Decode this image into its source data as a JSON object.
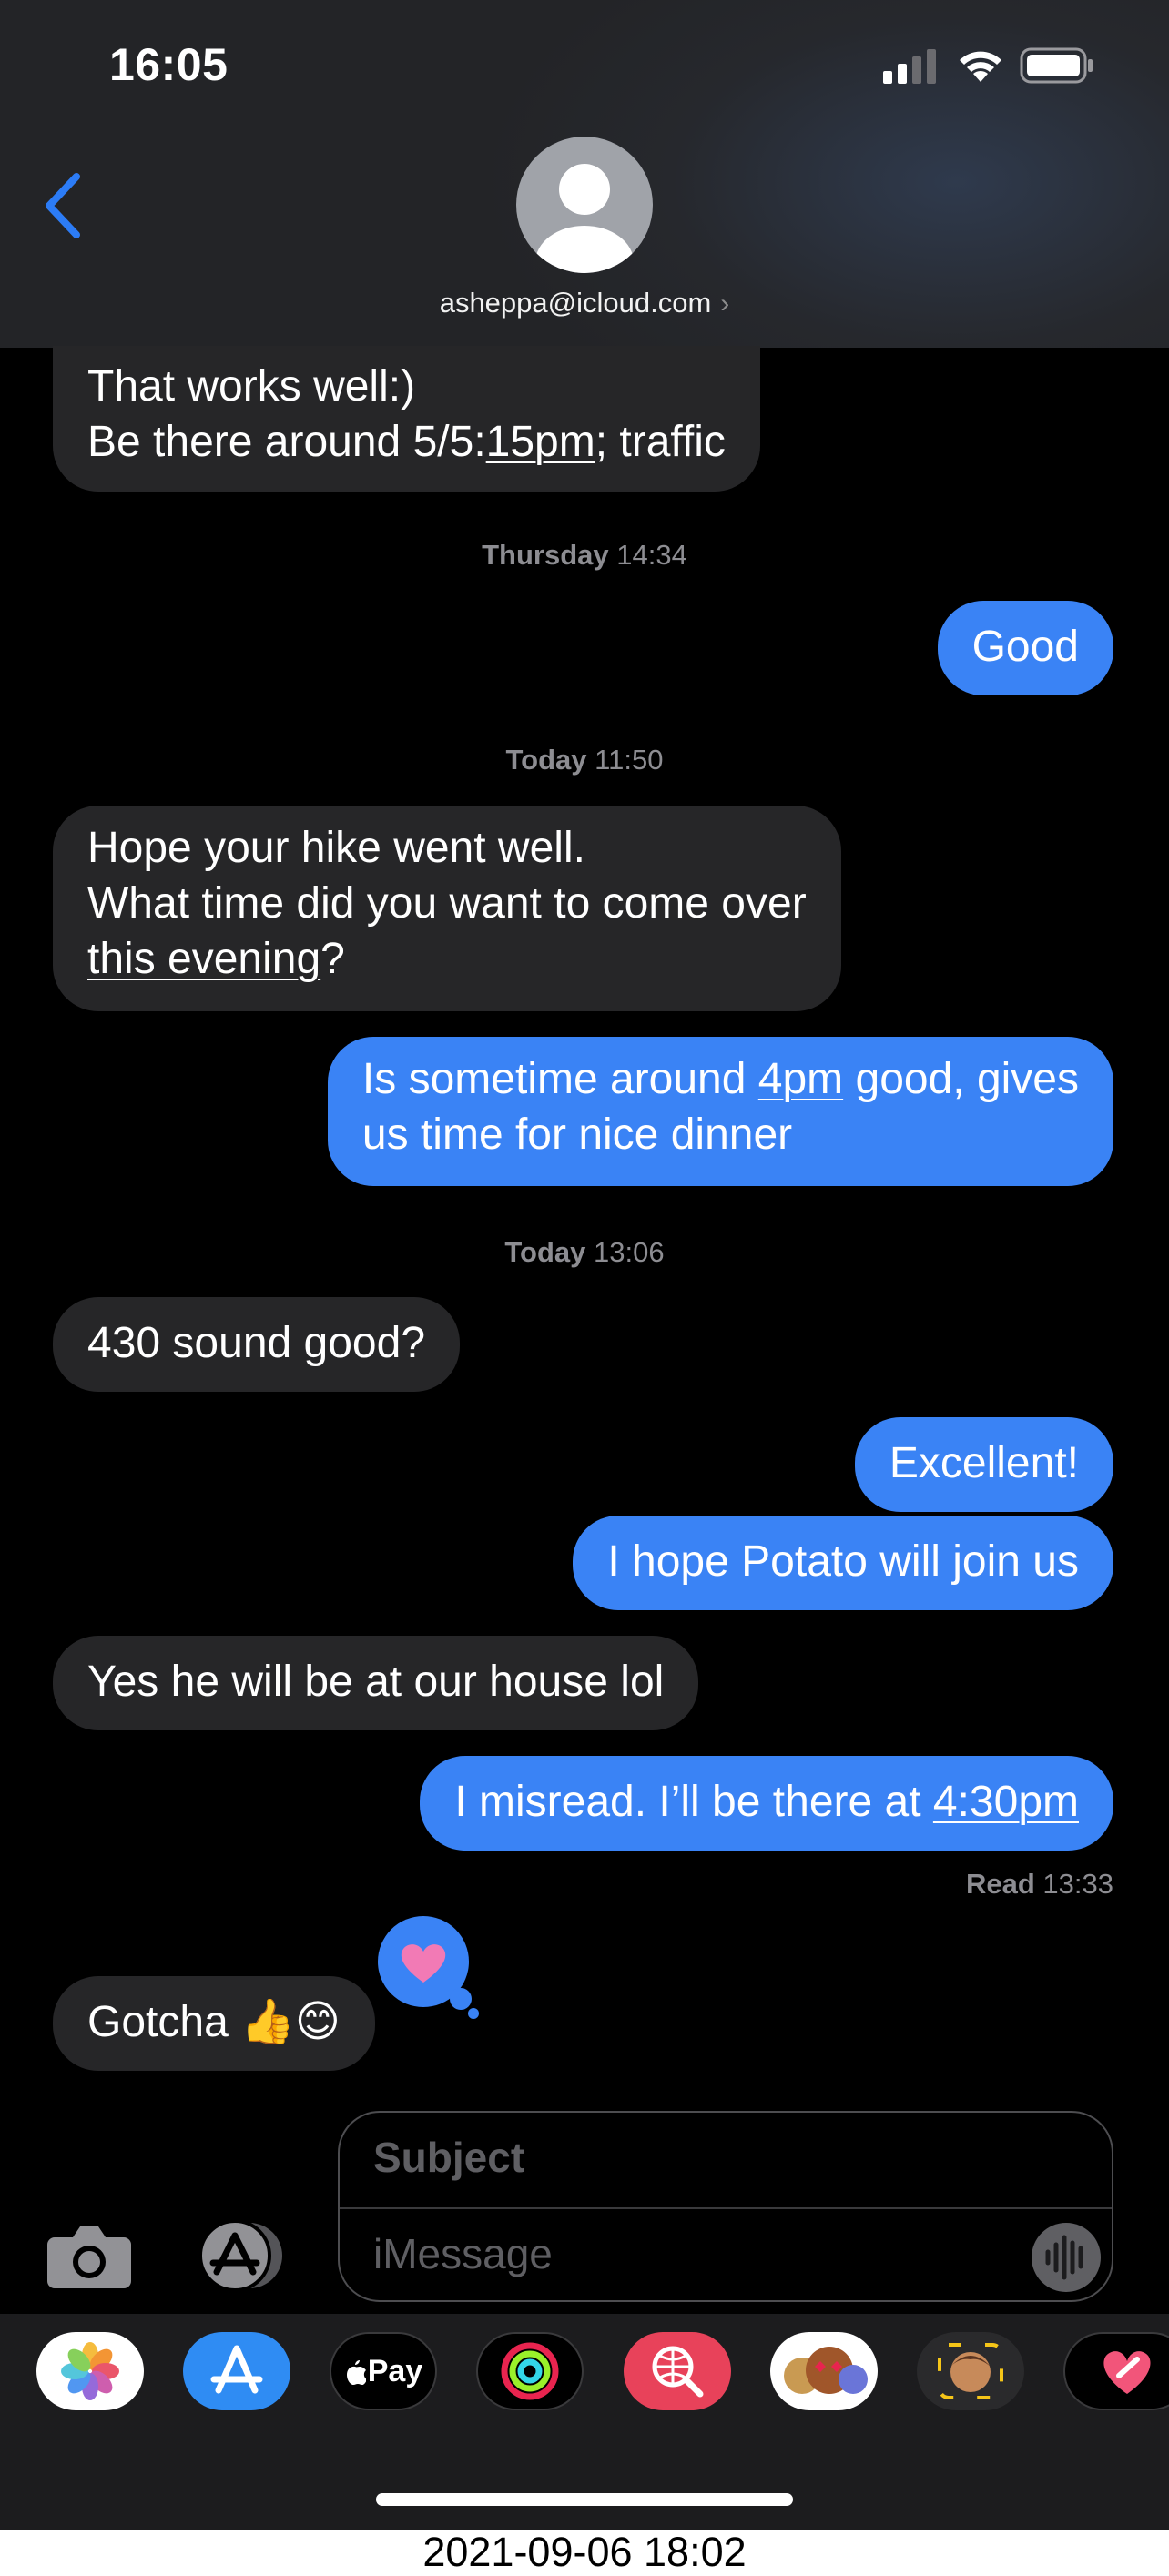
{
  "status_bar": {
    "time": "16:05"
  },
  "header": {
    "contact": "asheppa@icloud.com",
    "chevron": "›"
  },
  "messages": {
    "m1_line1": "That works well:)",
    "m1_line2_a": "Be there around 5/5:",
    "m1_line2_link": "15pm",
    "m1_line2_b": "; traffic",
    "ts1_day": "Thursday",
    "ts1_time": "14:34",
    "m2": "Good",
    "ts2_day": "Today",
    "ts2_time": "11:50",
    "m3_line1": "Hope your hike went well.",
    "m3_line2": "What time did you want to come over",
    "m3_line3_link": "this evening",
    "m3_line3_b": "?",
    "m4_line1_a": "Is sometime around ",
    "m4_line1_link": "4pm",
    "m4_line1_b": " good, gives",
    "m4_line2": "us time for nice dinner",
    "ts3_day": "Today",
    "ts3_time": "13:06",
    "m5": "430 sound good?",
    "m6": "Excellent!",
    "m7": "I hope Potato will join us",
    "m8": "Yes he will be at our house lol",
    "m9_a": "I misread.  I’ll be there at ",
    "m9_link": "4:30pm",
    "read_label": "Read",
    "read_time": "13:33",
    "m10": "Gotcha 👍😊",
    "tapback": "heart"
  },
  "input": {
    "subject_placeholder": "Subject",
    "message_placeholder": "iMessage"
  },
  "app_drawer": {
    "apps": [
      "photos-app",
      "app-store",
      "apple-pay",
      "activity",
      "images-search",
      "memoji-stickers",
      "animoji",
      "digital-touch"
    ],
    "applepay_label": "Pay"
  },
  "footer": {
    "timestamp": "2021-09-06 18:02"
  },
  "colors": {
    "outgoing": "#3a83f5",
    "incoming": "#262628",
    "accent": "#2c7cf6",
    "heart": "#f27ab5"
  }
}
